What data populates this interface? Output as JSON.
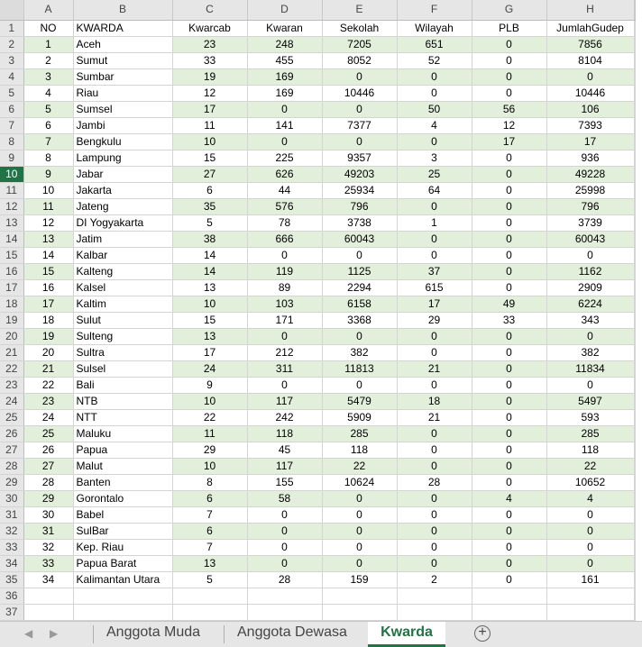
{
  "columns": [
    "A",
    "B",
    "C",
    "D",
    "E",
    "F",
    "G",
    "H"
  ],
  "header_row": [
    "NO",
    "KWARDA",
    "Kwarcab",
    "Kwaran",
    "Sekolah",
    "Wilayah",
    "PLB",
    "JumlahGudep"
  ],
  "rows": [
    [
      "1",
      "Aceh",
      "23",
      "248",
      "7205",
      "651",
      "0",
      "7856"
    ],
    [
      "2",
      "Sumut",
      "33",
      "455",
      "8052",
      "52",
      "0",
      "8104"
    ],
    [
      "3",
      "Sumbar",
      "19",
      "169",
      "0",
      "0",
      "0",
      "0"
    ],
    [
      "4",
      "Riau",
      "12",
      "169",
      "10446",
      "0",
      "0",
      "10446"
    ],
    [
      "5",
      "Sumsel",
      "17",
      "0",
      "0",
      "50",
      "56",
      "106"
    ],
    [
      "6",
      "Jambi",
      "11",
      "141",
      "7377",
      "4",
      "12",
      "7393"
    ],
    [
      "7",
      "Bengkulu",
      "10",
      "0",
      "0",
      "0",
      "17",
      "17"
    ],
    [
      "8",
      "Lampung",
      "15",
      "225",
      "9357",
      "3",
      "0",
      "936"
    ],
    [
      "9",
      "Jabar",
      "27",
      "626",
      "49203",
      "25",
      "0",
      "49228"
    ],
    [
      "10",
      "Jakarta",
      "6",
      "44",
      "25934",
      "64",
      "0",
      "25998"
    ],
    [
      "11",
      "Jateng",
      "35",
      "576",
      "796",
      "0",
      "0",
      "796"
    ],
    [
      "12",
      "DI Yogyakarta",
      "5",
      "78",
      "3738",
      "1",
      "0",
      "3739"
    ],
    [
      "13",
      "Jatim",
      "38",
      "666",
      "60043",
      "0",
      "0",
      "60043"
    ],
    [
      "14",
      "Kalbar",
      "14",
      "0",
      "0",
      "0",
      "0",
      "0"
    ],
    [
      "15",
      "Kalteng",
      "14",
      "119",
      "1125",
      "37",
      "0",
      "1162"
    ],
    [
      "16",
      "Kalsel",
      "13",
      "89",
      "2294",
      "615",
      "0",
      "2909"
    ],
    [
      "17",
      "Kaltim",
      "10",
      "103",
      "6158",
      "17",
      "49",
      "6224"
    ],
    [
      "18",
      "Sulut",
      "15",
      "171",
      "3368",
      "29",
      "33",
      "343"
    ],
    [
      "19",
      "Sulteng",
      "13",
      "0",
      "0",
      "0",
      "0",
      "0"
    ],
    [
      "20",
      "Sultra",
      "17",
      "212",
      "382",
      "0",
      "0",
      "382"
    ],
    [
      "21",
      "Sulsel",
      "24",
      "311",
      "11813",
      "21",
      "0",
      "11834"
    ],
    [
      "22",
      "Bali",
      "9",
      "0",
      "0",
      "0",
      "0",
      "0"
    ],
    [
      "23",
      "NTB",
      "10",
      "117",
      "5479",
      "18",
      "0",
      "5497"
    ],
    [
      "24",
      "NTT",
      "22",
      "242",
      "5909",
      "21",
      "0",
      "593"
    ],
    [
      "25",
      "Maluku",
      "11",
      "118",
      "285",
      "0",
      "0",
      "285"
    ],
    [
      "26",
      "Papua",
      "29",
      "45",
      "118",
      "0",
      "0",
      "118"
    ],
    [
      "27",
      "Malut",
      "10",
      "117",
      "22",
      "0",
      "0",
      "22"
    ],
    [
      "28",
      "Banten",
      "8",
      "155",
      "10624",
      "28",
      "0",
      "10652"
    ],
    [
      "29",
      "Gorontalo",
      "6",
      "58",
      "0",
      "0",
      "4",
      "4"
    ],
    [
      "30",
      "Babel",
      "7",
      "0",
      "0",
      "0",
      "0",
      "0"
    ],
    [
      "31",
      "SulBar",
      "6",
      "0",
      "0",
      "0",
      "0",
      "0"
    ],
    [
      "32",
      "Kep. Riau",
      "7",
      "0",
      "0",
      "0",
      "0",
      "0"
    ],
    [
      "33",
      "Papua Barat",
      "13",
      "0",
      "0",
      "0",
      "0",
      "0"
    ],
    [
      "34",
      "Kalimantan Utara",
      "5",
      "28",
      "159",
      "2",
      "0",
      "161"
    ]
  ],
  "row_numbers_total": 37,
  "selected_row": 10,
  "colors": {
    "accent": "#217346",
    "row_fill": "#e2efda",
    "header_bg": "#e6e6e6"
  },
  "tabs": [
    {
      "label": "Anggota Muda",
      "active": false
    },
    {
      "label": "Anggota Dewasa",
      "active": false
    },
    {
      "label": "Kwarda",
      "active": true
    }
  ],
  "nav_icons": [
    "scroll-left-icon",
    "scroll-right-icon"
  ],
  "add_sheet_icon": "plus-circle-icon"
}
